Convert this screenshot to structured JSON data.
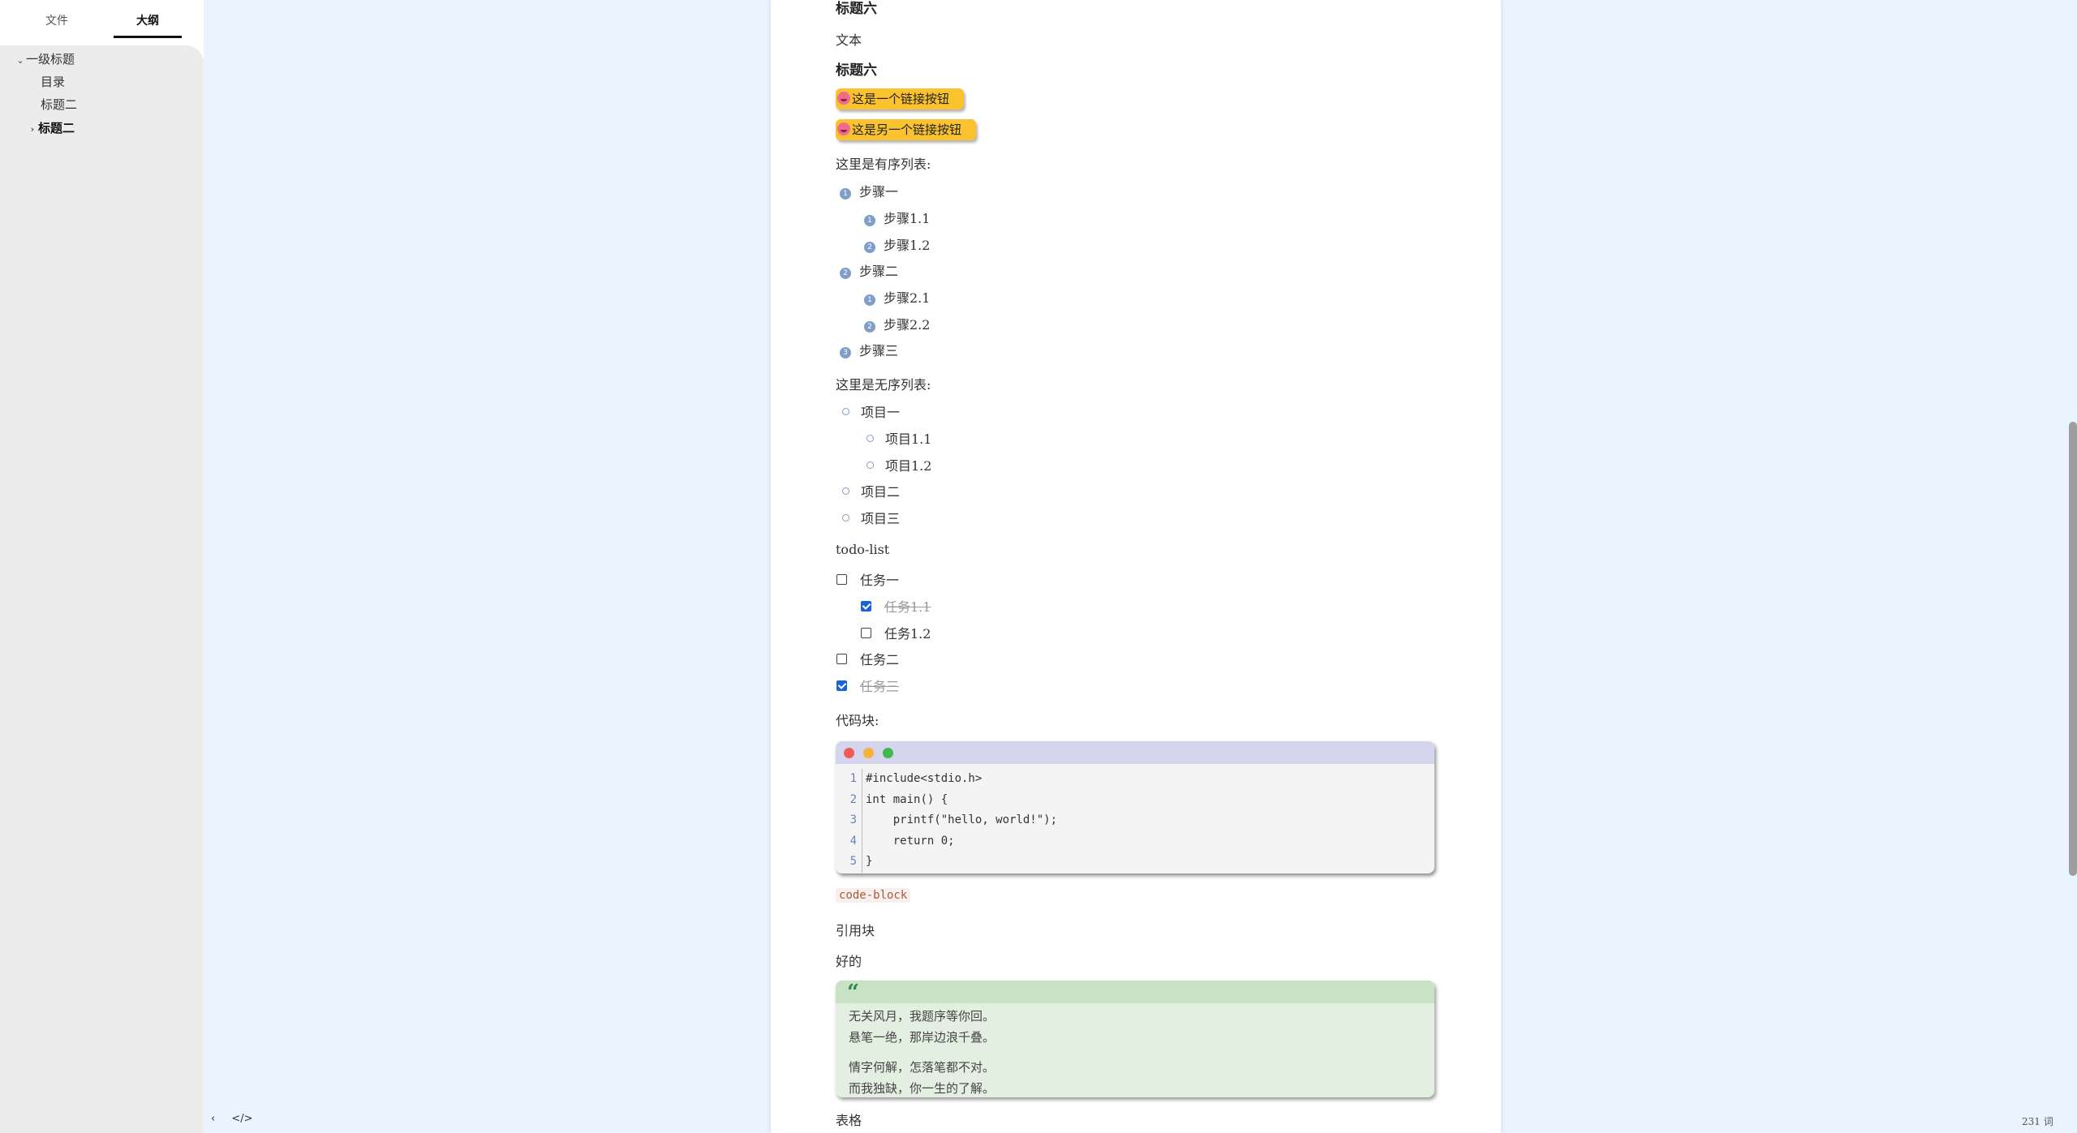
{
  "sidebar": {
    "tabs": [
      {
        "label": "文件"
      },
      {
        "label": "大纲"
      }
    ],
    "outline": [
      {
        "label": "一级标题",
        "chevron": "⌄"
      },
      {
        "label": "目录"
      },
      {
        "label": "标题二"
      },
      {
        "label": "标题二",
        "chevron": "›"
      }
    ],
    "footer": {
      "back_icon": "‹",
      "source_icon": "</>"
    }
  },
  "doc": {
    "heading_top": "标题六",
    "text": "文本",
    "heading6": "标题六",
    "link_buttons": [
      "这是一个链接按钮",
      "这是另一个链接按钮"
    ],
    "ordered_intro": "这里是有序列表:",
    "ordered": [
      {
        "num": "1",
        "label": "步骤一"
      },
      {
        "num": "1",
        "label": "步骤1.1"
      },
      {
        "num": "2",
        "label": "步骤1.2"
      },
      {
        "num": "2",
        "label": "步骤二"
      },
      {
        "num": "1",
        "label": "步骤2.1"
      },
      {
        "num": "2",
        "label": "步骤2.2"
      },
      {
        "num": "3",
        "label": "步骤三"
      }
    ],
    "unordered_intro": "这里是无序列表:",
    "unordered": [
      "项目一",
      "项目1.1",
      "项目1.2",
      "项目二",
      "项目三"
    ],
    "todo_title": "todo-list",
    "todos": [
      {
        "label": "任务一",
        "checked": false
      },
      {
        "label": "任务1.1",
        "checked": true
      },
      {
        "label": "任务1.2",
        "checked": false
      },
      {
        "label": "任务二",
        "checked": false
      },
      {
        "label": "任务三",
        "checked": true
      }
    ],
    "code_intro": "代码块:",
    "code": {
      "line_numbers": [
        "1",
        "2",
        "3",
        "4",
        "5"
      ],
      "line1": "#include<stdio.h>",
      "line2_type": "int",
      "line2_fn": "main",
      "line2_rest": "() {",
      "line3_indent": "    ",
      "line3_fn": "printf",
      "line3_open": "(",
      "line3_str": "\"hello, world!\"",
      "line3_close": ");",
      "line4_indent": "    ",
      "line4_kw": "return",
      "line4_rest": " 0;",
      "line5": "}"
    },
    "inline_code": "code-block",
    "quote_title": "引用块",
    "quote_intro": "好的",
    "quote_mark": "“",
    "quote_lines": [
      "无关风月，我题序等你回。",
      "悬笔一绝，那岸边浪千叠。",
      "情字何解，怎落笔都不对。",
      "而我独缺，你一生的了解。"
    ],
    "table_title": "表格"
  },
  "status": {
    "word_count": "231 词"
  }
}
